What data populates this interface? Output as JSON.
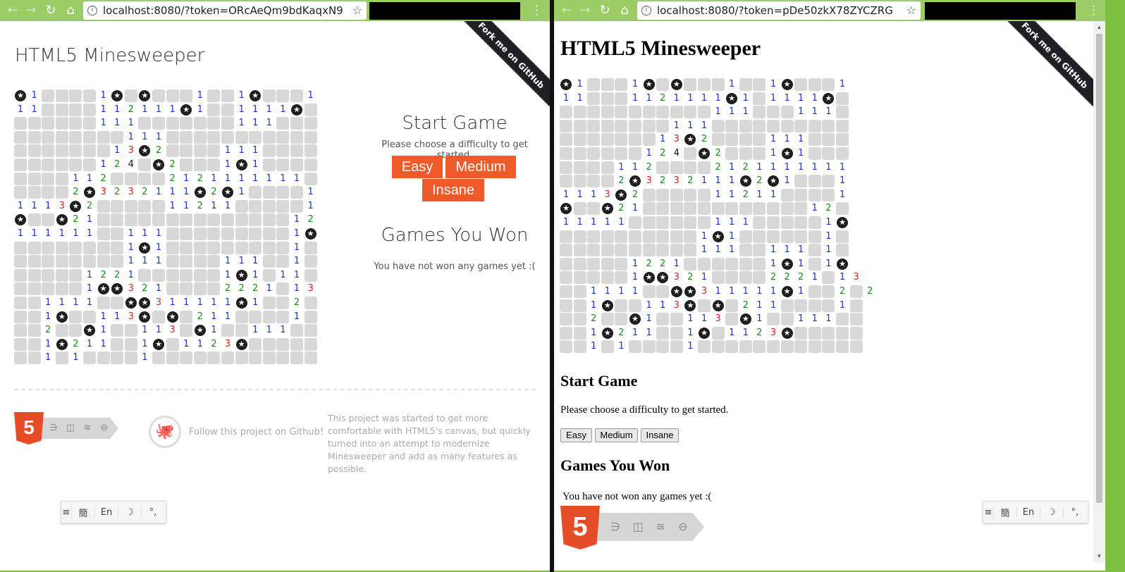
{
  "left": {
    "url": "localhost:8080/?token=ORcAeQm9bdKaqxN9",
    "ribbon": "Fork me on GitHub",
    "title": "HTML5 Minesweeper",
    "start_heading": "Start Game",
    "start_text": "Please choose a difficulty to get started.",
    "buttons": [
      "Easy",
      "Medium",
      "Insane"
    ],
    "won_heading": "Games You Won",
    "won_text": "You have not won any games yet :(",
    "html5_badge": "5",
    "badge_icons": [
      "css3-icon",
      "device-icon",
      "layers-icon",
      "connectivity-icon"
    ],
    "follow_text": "Follow this project on Github!",
    "description": "This project was started to get more comfortable with HTML5's canvas, but quickly turned into an attempt to modernize Minesweeper and add as many features as possible.",
    "ime": [
      "≡",
      "簡",
      "En",
      "☽",
      "°,"
    ],
    "board": [
      "m1....1m.m...1..1m...1",
      "11....112111m1..1111m.",
      "......111.......111...",
      "........111...........",
      ".......13m2....111....",
      "......124.m2...1m1....",
      "....112....2121111111.",
      "....2m3232111m2m1....1",
      "1113m2.....11211.....1",
      "m..m21..............12",
      "111111..111.........1m",
      "........1m1.........1.",
      "........111....111..1.",
      ".....1221......1m1.11.",
      ".....1mm321....2221.13",
      "..1111..mm311111m1..2.",
      "..1m..113m.m.211....1.",
      "..2..m1..113.m1..111..",
      "..1m211..1m.1123m.....",
      "..1.1....1............"
    ]
  },
  "right": {
    "url": "localhost:8080/?token=pDe50zkX78ZYCZRG",
    "ribbon": "Fork me on GitHub",
    "title": "HTML5 Minesweeper",
    "start_heading": "Start Game",
    "start_text": "Please choose a difficulty to get started.",
    "buttons": [
      "Easy",
      "Medium",
      "Insane"
    ],
    "won_heading": "Games You Won",
    "won_text": "You have not won any games yet :(",
    "html5_badge": "5",
    "badge_icons": [
      "css3-icon",
      "device-icon",
      "layers-icon",
      "connectivity-icon"
    ],
    "ime": [
      "≡",
      "簡",
      "En",
      "☽",
      "°,"
    ],
    "board": [
      "m1...1m.m...1..1m...1",
      "11...1121111m1.1111m.",
      "...........111...111.",
      "........111..........",
      ".......13m2....111...",
      "......124.m2...1m1...",
      "....112....2121111111",
      "....2m3232111m2m1...1",
      "1113m2.....11211....1",
      "m..m21............12.",
      "11111......111.....1m",
      "..........1m1......1.",
      "..........111..111.1.",
      ".....1221......1m1.1m",
      ".....1mm321....2221.13",
      "..1111..mm311111m1..2.2",
      "..1m..113m.m.211....1.",
      "..2..m1..113.m1..111..",
      "..1m211..1m.1123m.....",
      "..1.1....1............"
    ]
  }
}
